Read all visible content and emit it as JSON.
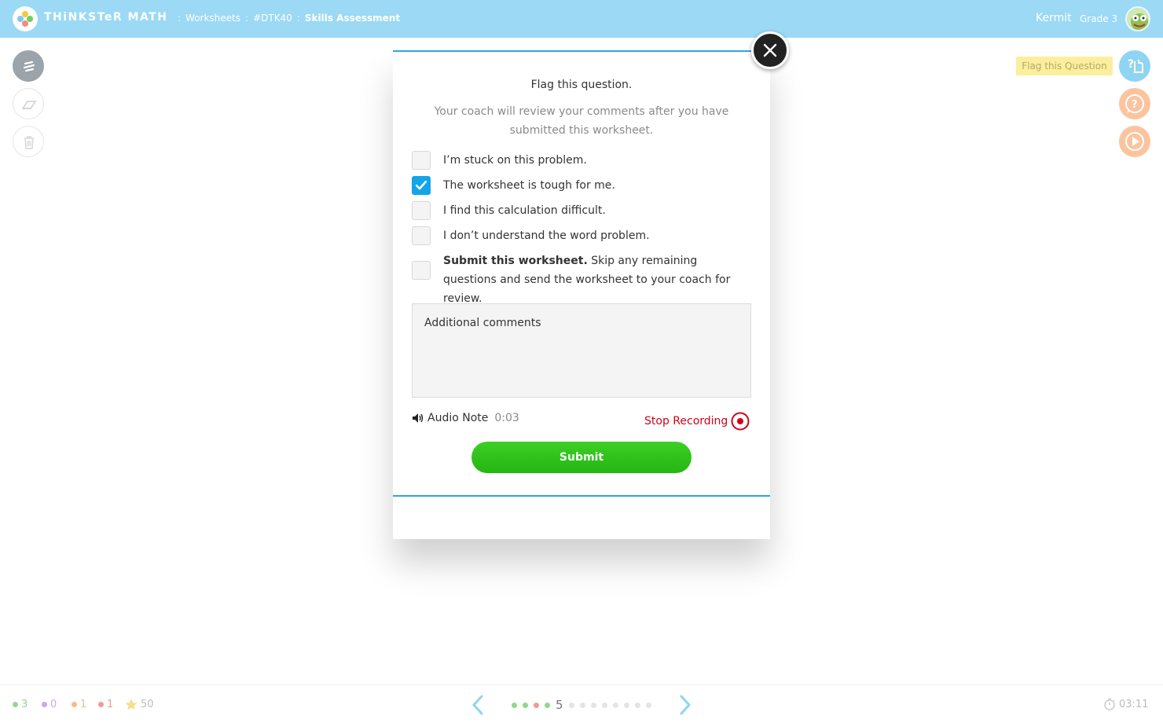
{
  "header": {
    "logo_text": "THiNKSTeR MATH",
    "breadcrumbs": [
      ":",
      "Worksheets",
      ":",
      "#DTK40",
      ":",
      "Skills Assessment"
    ],
    "user_name": "Kermit",
    "grade": "Grade 3"
  },
  "right_tools": {
    "flag_tooltip": "Flag this Question"
  },
  "modal": {
    "title": "Flag this question.",
    "subtitle": "Your coach will review your comments after you have submitted this worksheet.",
    "options": [
      {
        "label": "I’m stuck on this problem.",
        "checked": false
      },
      {
        "label": "The worksheet is tough for me.",
        "checked": true
      },
      {
        "label": "I find this calculation difficult.",
        "checked": false
      },
      {
        "label": "I don’t understand the word problem.",
        "checked": false
      }
    ],
    "submit_option": {
      "bold": "Submit this worksheet.",
      "rest": " Skip any remaining questions and send the worksheet to your coach for review.",
      "checked": false
    },
    "comments_placeholder": "Additional comments",
    "audio_label": "Audio Note",
    "audio_time": "0:03",
    "stop_label": "Stop Recording",
    "submit_label": "Submit"
  },
  "footer": {
    "stats": [
      {
        "value": "3",
        "color": "#8fd98a"
      },
      {
        "value": "0",
        "color": "#c9a6f0"
      },
      {
        "value": "1",
        "color": "#f8b98a"
      },
      {
        "value": "1",
        "color": "#f29a92"
      }
    ],
    "stars": "50",
    "current_page": "5",
    "timer": "03:11"
  },
  "colors": {
    "header_bg": "#9bd9f5",
    "accent_blue": "#29a7e1",
    "checkbox_checked": "#12a5e8",
    "submit_green": "#2ec31a",
    "stop_red": "#d0021b",
    "tooltip_yellow": "#fbef9e"
  }
}
